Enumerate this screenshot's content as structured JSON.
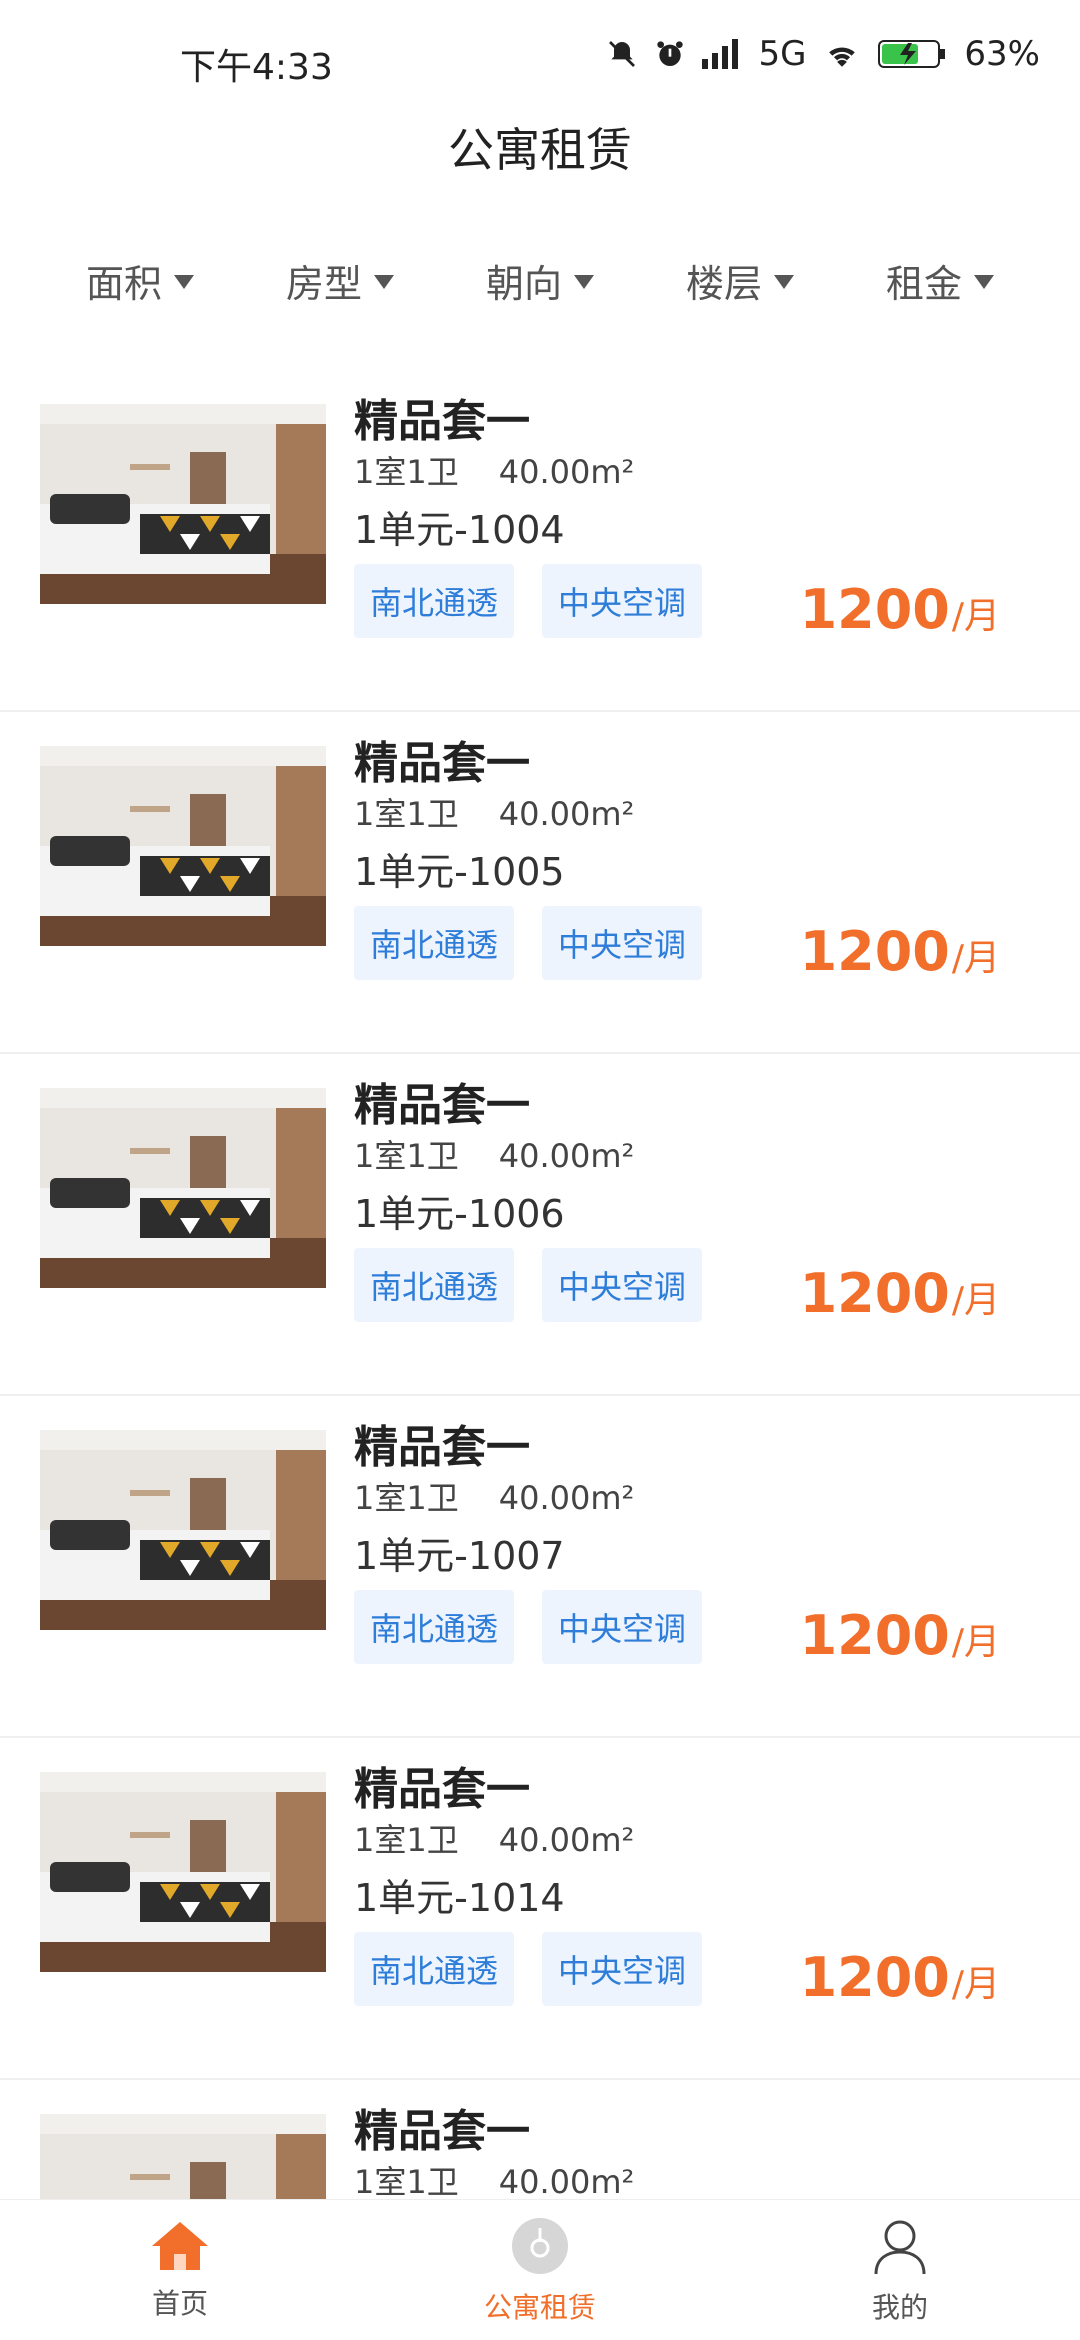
{
  "status_bar": {
    "time": "下午4:33",
    "network": "5G",
    "battery": "63%"
  },
  "header": {
    "title": "公寓租赁"
  },
  "filters": [
    {
      "label": "面积"
    },
    {
      "label": "房型"
    },
    {
      "label": "朝向"
    },
    {
      "label": "楼层"
    },
    {
      "label": "租金"
    }
  ],
  "listings": [
    {
      "name": "精品套一",
      "layout": "1室1卫",
      "area": "40.00m²",
      "unit": "1单元-1004",
      "tags": [
        "南北通透",
        "中央空调"
      ],
      "price": "1200",
      "per": "/月"
    },
    {
      "name": "精品套一",
      "layout": "1室1卫",
      "area": "40.00m²",
      "unit": "1单元-1005",
      "tags": [
        "南北通透",
        "中央空调"
      ],
      "price": "1200",
      "per": "/月"
    },
    {
      "name": "精品套一",
      "layout": "1室1卫",
      "area": "40.00m²",
      "unit": "1单元-1006",
      "tags": [
        "南北通透",
        "中央空调"
      ],
      "price": "1200",
      "per": "/月"
    },
    {
      "name": "精品套一",
      "layout": "1室1卫",
      "area": "40.00m²",
      "unit": "1单元-1007",
      "tags": [
        "南北通透",
        "中央空调"
      ],
      "price": "1200",
      "per": "/月"
    },
    {
      "name": "精品套一",
      "layout": "1室1卫",
      "area": "40.00m²",
      "unit": "1单元-1014",
      "tags": [
        "南北通透",
        "中央空调"
      ],
      "price": "1200",
      "per": "/月"
    },
    {
      "name": "精品套一",
      "layout": "1室1卫",
      "area": "40.00m²",
      "unit": "",
      "tags": [],
      "price": "",
      "per": ""
    }
  ],
  "tab_bar": {
    "tabs": [
      {
        "label": "首页",
        "icon": "home-icon"
      },
      {
        "label": "公寓租赁",
        "icon": "key-icon"
      },
      {
        "label": "我的",
        "icon": "person-icon"
      }
    ],
    "active_index": 1
  },
  "colors": {
    "accent": "#f26f2b",
    "tag_text": "#2d7dd9",
    "tag_bg": "#eef4fd"
  }
}
